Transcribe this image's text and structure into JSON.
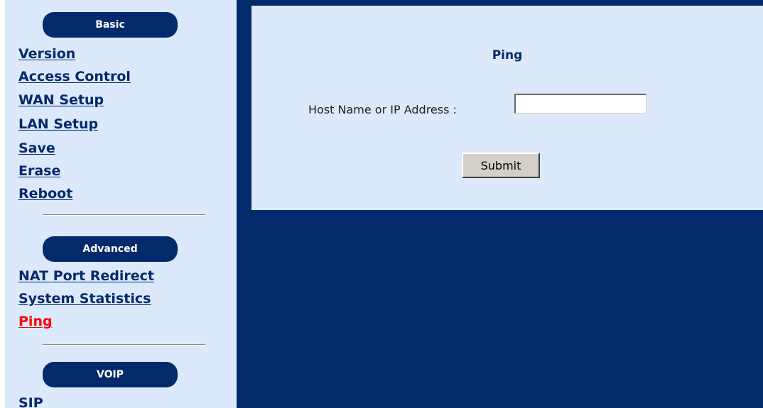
{
  "sidebar": {
    "sections": {
      "basic": {
        "title": "Basic",
        "items": [
          "Version",
          "Access Control",
          "WAN Setup",
          "LAN Setup",
          "Save",
          "Erase",
          "Reboot"
        ]
      },
      "advanced": {
        "title": "Advanced",
        "items": [
          "NAT Port Redirect",
          "System Statistics",
          "Ping"
        ],
        "active_item": "Ping"
      },
      "voip": {
        "title": "VOIP",
        "items": [
          "SIP"
        ]
      }
    }
  },
  "main": {
    "title": "Ping",
    "host_label": "Host Name or IP Address :",
    "host_value": "",
    "submit_label": "Submit"
  },
  "colors": {
    "navy": "#032a6b",
    "light_panel": "#dbe9fb",
    "active_link": "#ff0000"
  }
}
